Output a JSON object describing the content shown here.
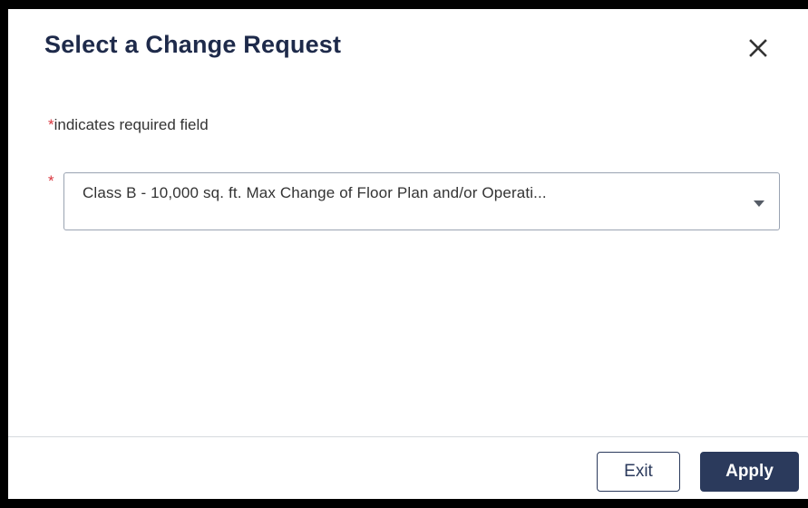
{
  "dialog": {
    "title": "Select a Change Request",
    "close_icon": "close-icon"
  },
  "form": {
    "required_asterisk": "*",
    "required_note": "indicates required field",
    "change_request": {
      "required_marker": "*",
      "selected_value": "Class B - 10,000 sq. ft. Max Change of Floor Plan and/or Operati...",
      "dropdown_icon": "chevron-down-icon"
    }
  },
  "footer": {
    "exit_label": "Exit",
    "apply_label": "Apply"
  },
  "colors": {
    "title": "#1e2a4a",
    "required": "#d9363e",
    "primary_button": "#2b3a5c",
    "border": "#9aa3b2"
  }
}
